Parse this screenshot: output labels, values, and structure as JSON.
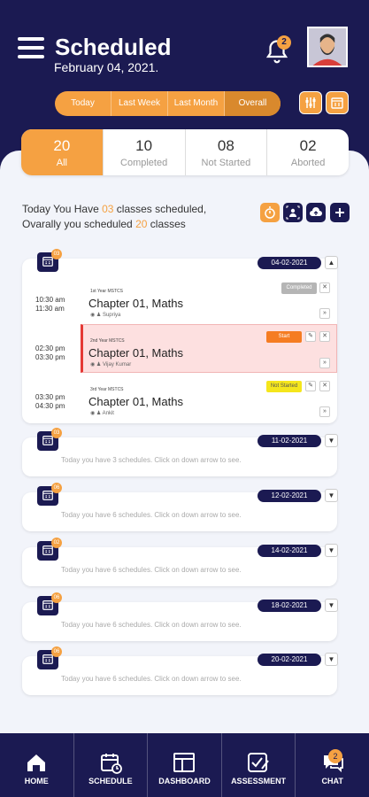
{
  "header": {
    "title": "Scheduled",
    "date": "February 04, 2021.",
    "notification_count": "2"
  },
  "filter_tabs": [
    "Today",
    "Last Week",
    "Last Month",
    "Overall"
  ],
  "stats": [
    {
      "value": "20",
      "label": "All"
    },
    {
      "value": "10",
      "label": "Completed"
    },
    {
      "value": "08",
      "label": "Not Started"
    },
    {
      "value": "02",
      "label": "Aborted"
    }
  ],
  "summary": {
    "line1_pre": "Today You Have ",
    "line1_count": "03",
    "line1_post": " classes scheduled,",
    "line2_pre": "Ovarally you scheduled ",
    "line2_count": "20",
    "line2_post": " classes"
  },
  "days": [
    {
      "date": "04-02-2021",
      "badge": "03",
      "classes": [
        {
          "start": "10:30 am",
          "end": "11:30 am",
          "meta": "1st Year MSTCS",
          "title": "Chapter 01, Maths",
          "teacher": "Supriya",
          "status": "Completed"
        },
        {
          "start": "02:30 pm",
          "end": "03:30 pm",
          "meta": "2nd Year MSTCS",
          "title": "Chapter 01, Maths",
          "teacher": "Vijay Kumar",
          "status": "Start"
        },
        {
          "start": "03:30 pm",
          "end": "04:30 pm",
          "meta": "3rd Year MSTCS",
          "title": "Chapter 01, Maths",
          "teacher": "Ankit",
          "status": "Not Started"
        }
      ]
    },
    {
      "date": "11-02-2021",
      "badge": "03",
      "text": "Today you have 3 schedules. Click on down arrow to see."
    },
    {
      "date": "12-02-2021",
      "badge": "06",
      "text": "Today you have 6 schedules. Click on down arrow to see."
    },
    {
      "date": "14-02-2021",
      "badge": "02",
      "text": "Today you have 6 schedules. Click on down arrow to see."
    },
    {
      "date": "18-02-2021",
      "badge": "06",
      "text": "Today you have 6 schedules. Click on down arrow to see."
    },
    {
      "date": "20-02-2021",
      "badge": "06",
      "text": "Today you have 6 schedules. Click on down arrow to see."
    }
  ],
  "nav": [
    {
      "label": "HOME",
      "icon": "home-icon"
    },
    {
      "label": "SCHEDULE",
      "icon": "schedule-icon"
    },
    {
      "label": "DASHBOARD",
      "icon": "dashboard-icon"
    },
    {
      "label": "ASSESSMENT",
      "icon": "assessment-icon"
    },
    {
      "label": "CHAT",
      "icon": "chat-icon",
      "badge": "2"
    }
  ],
  "colors": {
    "navy": "#1b1a52",
    "orange": "#f5a142",
    "red_highlight": "#fde0e0",
    "background": "#f2f4fa"
  }
}
